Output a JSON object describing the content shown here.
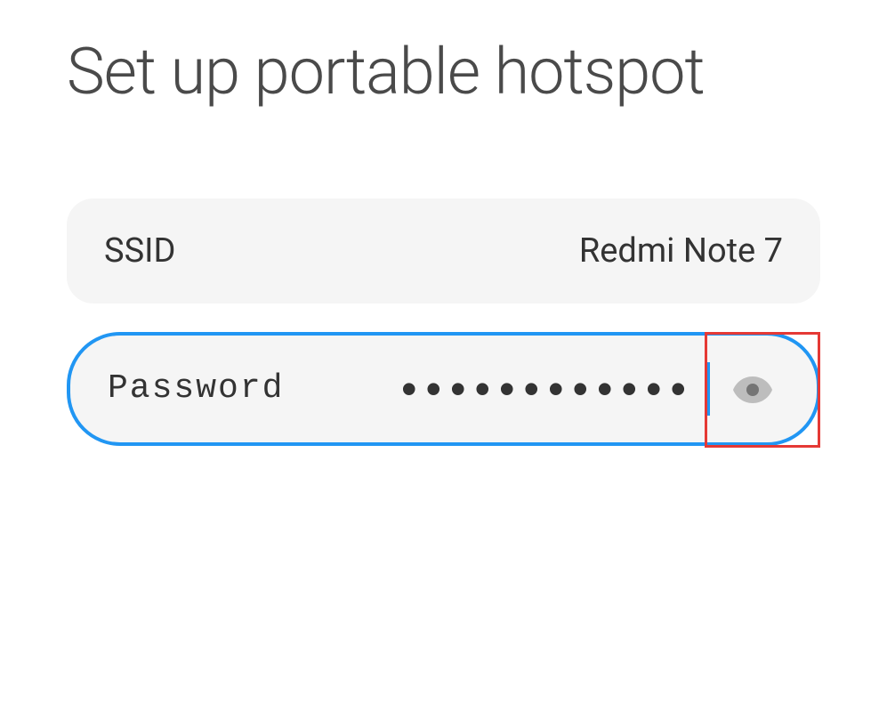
{
  "title": "Set up portable hotspot",
  "ssid": {
    "label": "SSID",
    "value": "Redmi Note 7"
  },
  "password": {
    "label": "Password",
    "masked_value": "••••••••••••",
    "visibility_icon": "eye-icon"
  }
}
